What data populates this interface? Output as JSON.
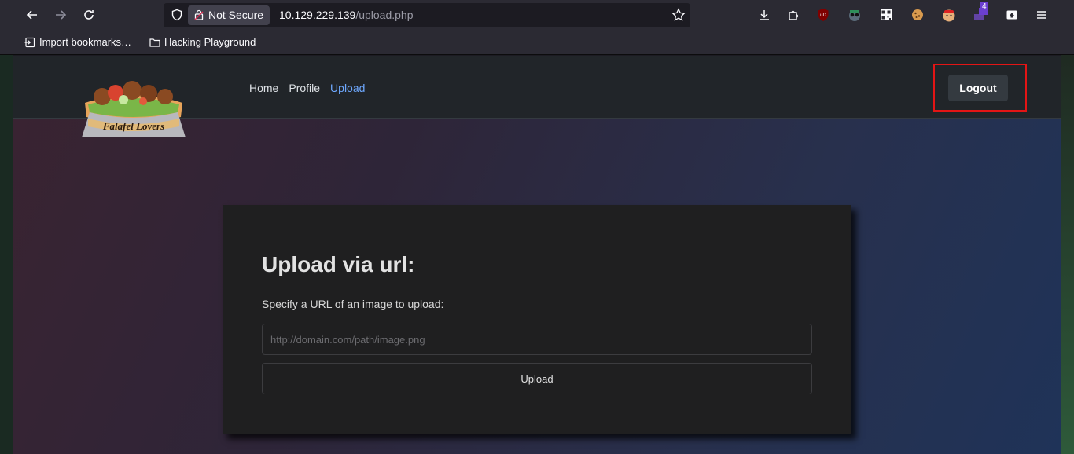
{
  "browser": {
    "security_label": "Not Secure",
    "url_host": "10.129.229.139",
    "url_path": "/upload.php",
    "extension_badge_count": "4",
    "bookmarks": [
      {
        "label": "Import bookmarks…",
        "icon": "import-icon"
      },
      {
        "label": "Hacking Playground",
        "icon": "folder-icon"
      }
    ]
  },
  "site": {
    "logo_text": "Falafel Lovers",
    "nav": {
      "items": [
        {
          "label": "Home",
          "active": false
        },
        {
          "label": "Profile",
          "active": false
        },
        {
          "label": "Upload",
          "active": true
        }
      ],
      "logout_label": "Logout"
    }
  },
  "upload_form": {
    "title": "Upload via url:",
    "instructions": "Specify a URL of an image to upload:",
    "url_placeholder": "http://domain.com/path/image.png",
    "url_value": "",
    "submit_label": "Upload"
  },
  "colors": {
    "highlight_box": "#e31515",
    "active_link": "#6ea8fe"
  }
}
